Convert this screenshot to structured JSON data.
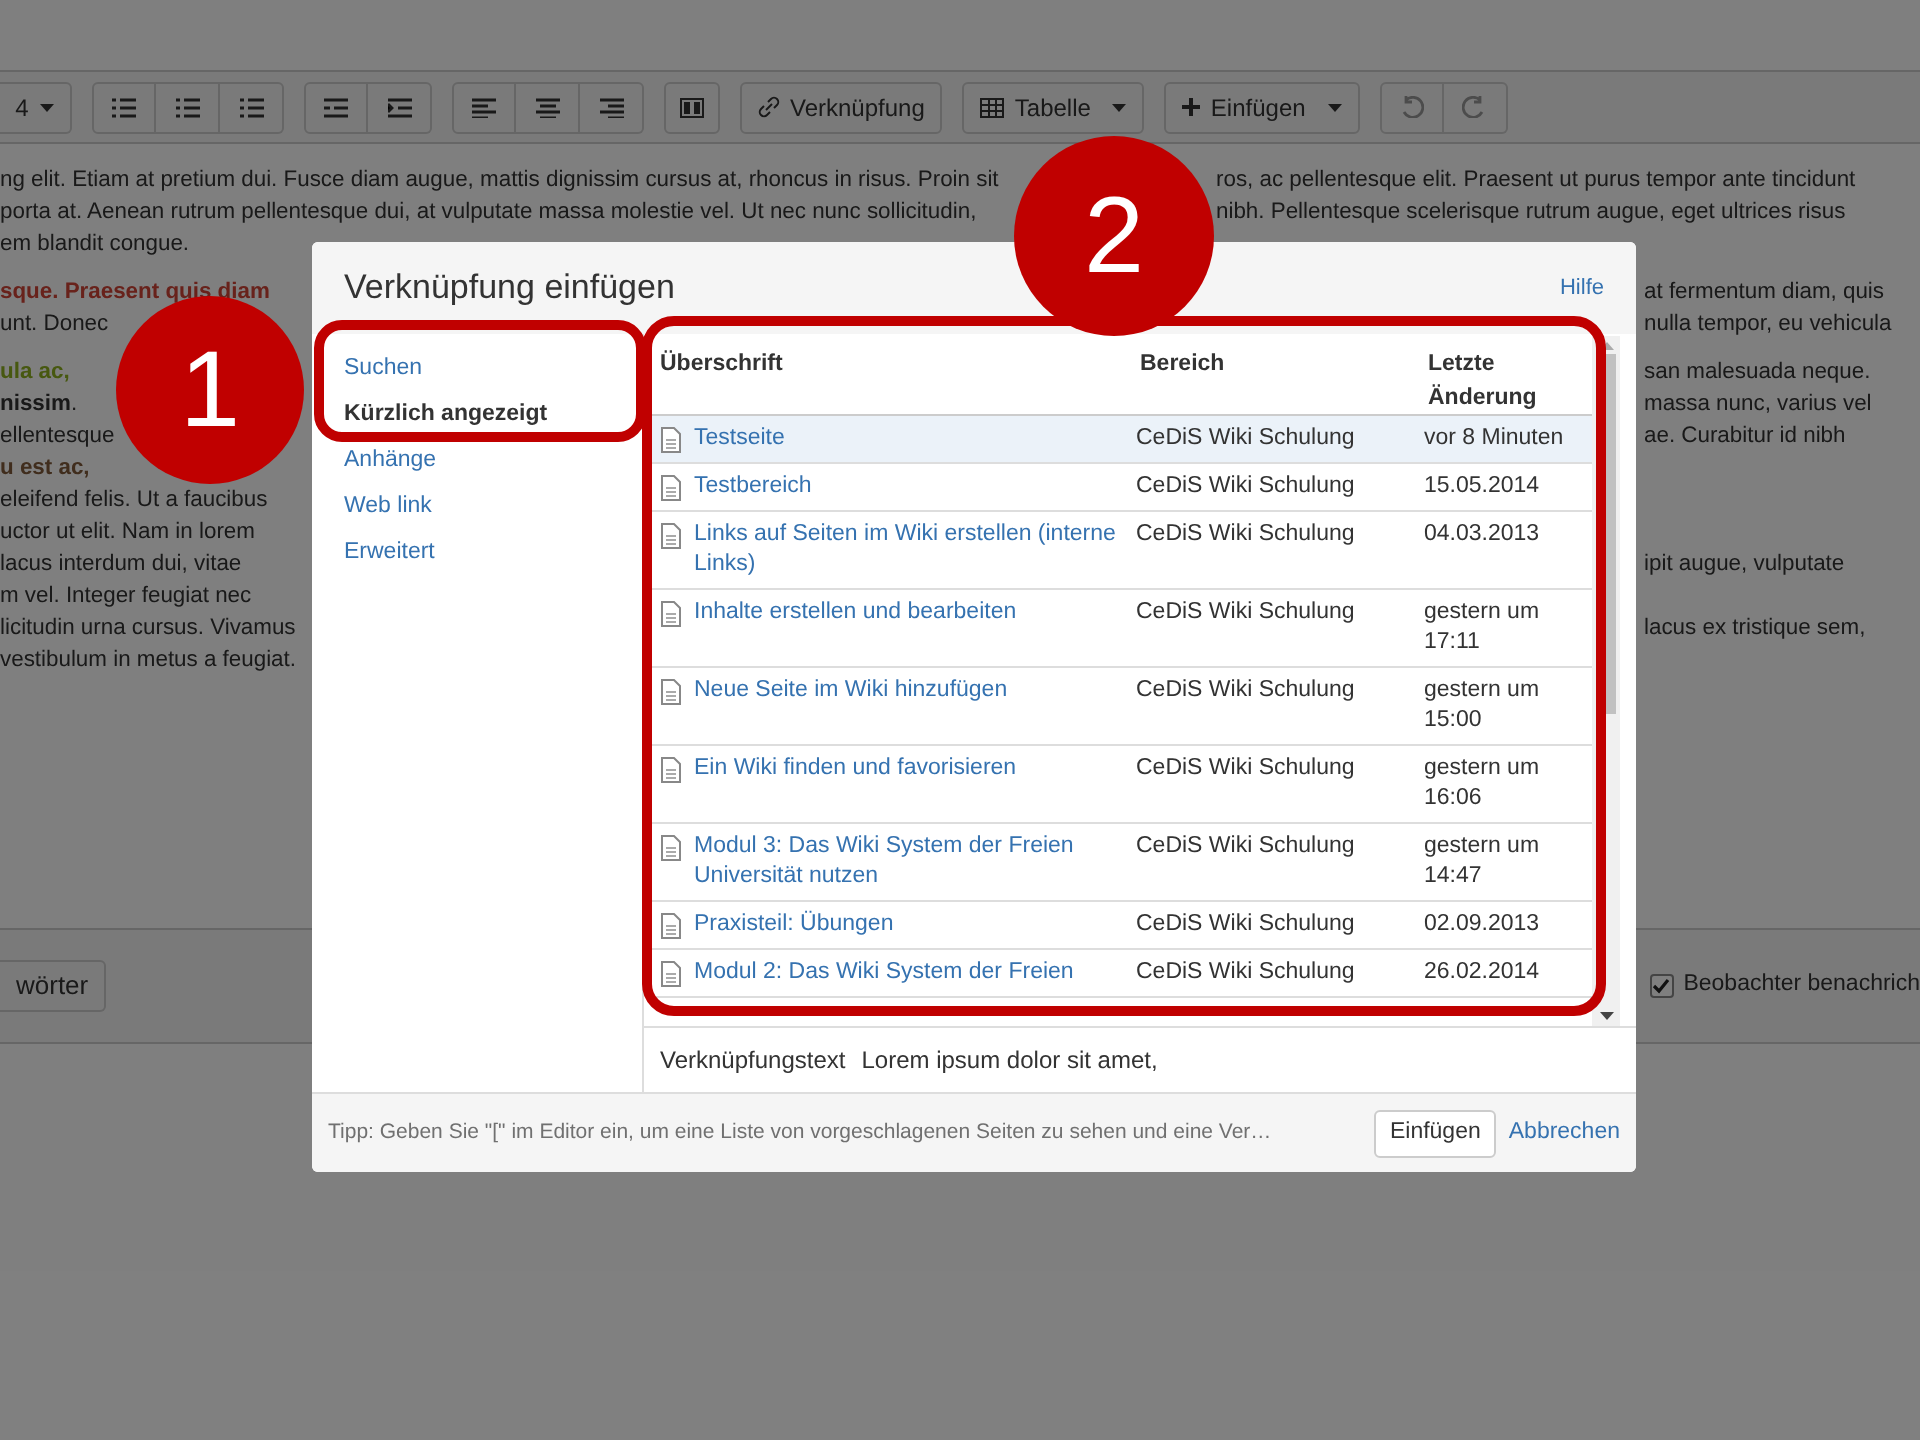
{
  "toolbar": {
    "size_value": "4",
    "buttons": [
      {
        "kind": "link",
        "label": "Verknüpfung"
      },
      {
        "kind": "table",
        "label": "Tabelle"
      },
      {
        "kind": "insert",
        "label": "Einfügen"
      }
    ]
  },
  "editor": {
    "paragraph_above_dialog": [
      {
        "left": "ng elit. Etiam at pretium dui. Fusce diam augue, mattis dignissim cursus at, rhoncus in risus. Proin sit",
        "kind": "plain",
        "right": "ros, ac pellentesque elit. Praesent ut purus tempor ante tincidunt"
      },
      {
        "left": "porta at. Aenean rutrum pellentesque dui, at vulputate massa molestie vel. Ut nec nunc sollicitudin,",
        "kind": "plain",
        "right": "nibh. Pellentesque scelerisque rutrum augue, eget ultrices risus"
      },
      {
        "left": "em blandit congue.",
        "kind": "plain"
      }
    ],
    "paragraphs_beside_dialog": [
      [
        {
          "left": "sque. Praesent quis diam",
          "kind": "bold-red",
          "right": "at fermentum diam, quis"
        },
        {
          "left": "unt. Donec",
          "kind": "plain",
          "right": "nulla tempor, eu vehicula"
        }
      ],
      [
        {
          "left": "ula ac,",
          "kind": "bold-green",
          "right": "san malesuada neque."
        },
        {
          "left": "**nissim**.",
          "kind": "plain",
          "right": "massa nunc, varius vel"
        },
        {
          "left": "ellentesque",
          "kind": "plain",
          "right": "ae. Curabitur id nibh"
        },
        {
          "left": "u est ac,",
          "kind": "bold-purple"
        },
        {
          "left": "eleifend felis. Ut a faucibus",
          "kind": "plain"
        },
        {
          "left": "uctor ut elit. Nam in lorem",
          "kind": "plain"
        },
        {
          "left": "lacus interdum dui, vitae",
          "kind": "plain",
          "right": "ipit augue, vulputate"
        },
        {
          "left": "m vel. Integer feugiat nec",
          "kind": "plain"
        },
        {
          "left": "licitudin urna cursus. Vivamus",
          "kind": "plain",
          "right": "lacus ex tristique sem,"
        },
        {
          "left": "vestibulum in metus a feugiat.",
          "kind": "plain"
        }
      ]
    ]
  },
  "bottom_bar": {
    "button": "wörter",
    "checkbox": {
      "label": "Beobachter benachrich",
      "checked": true
    }
  },
  "dialog": {
    "title": "Verknüpfung einfügen",
    "help": "Hilfe",
    "sidebar": [
      {
        "label": "Suchen",
        "selected": false
      },
      {
        "label": "Kürzlich angezeigt",
        "selected": true
      },
      {
        "label": "Anhänge",
        "selected": false
      },
      {
        "label": "Web link",
        "selected": false
      },
      {
        "label": "Erweitert",
        "selected": false
      }
    ],
    "table": {
      "columns": [
        "Überschrift",
        "Bereich",
        "Letzte Änderung"
      ],
      "rows": [
        {
          "title": "Testseite",
          "space": "CeDiS Wiki Schulung",
          "modified": "vor 8 Minuten",
          "selected": true
        },
        {
          "title": "Testbereich",
          "space": "CeDiS Wiki Schulung",
          "modified": "15.05.2014",
          "selected": false
        },
        {
          "title": "Links auf Seiten im Wiki erstellen (interne Links)",
          "space": "CeDiS Wiki Schulung",
          "modified": "04.03.2013",
          "selected": false
        },
        {
          "title": "Inhalte erstellen und bearbeiten",
          "space": "CeDiS Wiki Schulung",
          "modified": "gestern um 17:11",
          "selected": false
        },
        {
          "title": "Neue Seite im Wiki hinzufügen",
          "space": "CeDiS Wiki Schulung",
          "modified": "gestern um 15:00",
          "selected": false
        },
        {
          "title": "Ein Wiki finden und favorisieren",
          "space": "CeDiS Wiki Schulung",
          "modified": "gestern um 16:06",
          "selected": false
        },
        {
          "title": "Modul 3: Das Wiki System der Freien Universität nutzen",
          "space": "CeDiS Wiki Schulung",
          "modified": "gestern um 14:47",
          "selected": false
        },
        {
          "title": "Praxisteil: Übungen",
          "space": "CeDiS Wiki Schulung",
          "modified": "02.09.2013",
          "selected": false
        },
        {
          "title": "Modul 2: Das Wiki System der Freien",
          "space": "CeDiS Wiki Schulung",
          "modified": "26.02.2014",
          "selected": false
        }
      ]
    },
    "link_text": {
      "label": "Verknüpfungstext",
      "value": "Lorem ipsum dolor sit amet,"
    },
    "footer": {
      "tip": "Tipp: Geben Sie \"[\" im Editor ein, um eine Liste von vorgeschlagenen Seiten zu sehen und eine Ver…",
      "insert": "Einfügen",
      "cancel": "Abbrechen"
    }
  },
  "callouts": [
    "1",
    "2"
  ]
}
